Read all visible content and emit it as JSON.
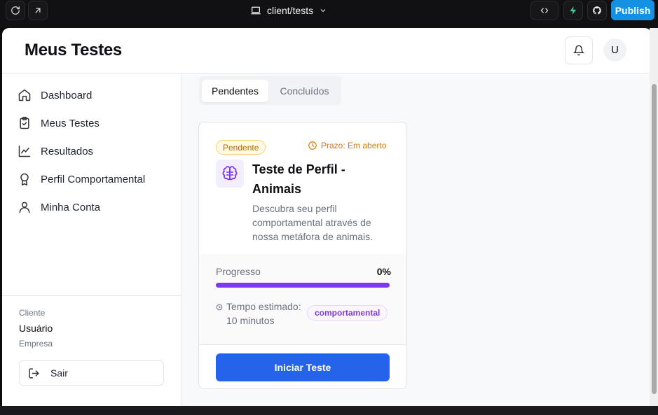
{
  "topbar": {
    "url_label": "client/tests",
    "publish_label": "Publish"
  },
  "header": {
    "title": "Meus Testes",
    "avatar_initial": "U"
  },
  "sidebar": {
    "items": [
      {
        "label": "Dashboard",
        "icon": "home-icon"
      },
      {
        "label": "Meus Testes",
        "icon": "clipboard-check-icon"
      },
      {
        "label": "Resultados",
        "icon": "line-chart-icon"
      },
      {
        "label": "Perfil Comportamental",
        "icon": "award-icon"
      },
      {
        "label": "Minha Conta",
        "icon": "user-icon"
      }
    ],
    "client_label": "Cliente",
    "client_name": "Usuário",
    "client_company": "Empresa",
    "logout_label": "Sair"
  },
  "main": {
    "tabs": [
      {
        "label": "Pendentes",
        "active": true
      },
      {
        "label": "Concluídos",
        "active": false
      }
    ],
    "card": {
      "status": "Pendente",
      "deadline": "Prazo: Em aberto",
      "title": "Teste de Perfil - Animais",
      "description": "Descubra seu perfil comportamental através de nossa metáfora de animais.",
      "progress_label": "Progresso",
      "progress_value": "0%",
      "progress_fraction": 0,
      "time_estimate": "Tempo estimado: 10 minutos",
      "category": "comportamental",
      "button_label": "Iniciar Teste"
    }
  },
  "colors": {
    "accent_blue": "#2563eb",
    "accent_purple": "#7c3aed",
    "publish_blue": "#1491e2",
    "pending_amber": "#d97706"
  }
}
